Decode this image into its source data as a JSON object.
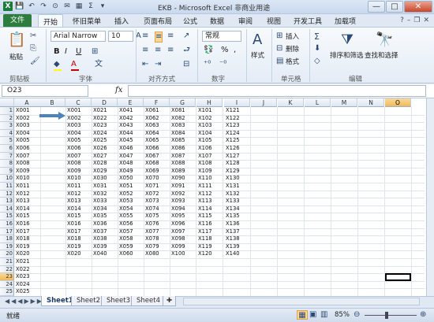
{
  "window": {
    "title": "EKB - Microsoft Excel 非商业用途",
    "controls": [
      "—",
      "□",
      "✕"
    ]
  },
  "qat": {
    "app_icon": "X",
    "save": "💾",
    "undo": "↶",
    "redo": "↷",
    "extra": [
      "⊙",
      "✉",
      "▦",
      "Σ",
      "▾"
    ]
  },
  "tabs": {
    "file": "文件",
    "items": [
      "开始",
      "怀旧菜单",
      "插入",
      "页面布局",
      "公式",
      "数据",
      "审阅",
      "视图",
      "开发工具",
      "加载项"
    ],
    "active": 0
  },
  "ribbon": {
    "clipboard": {
      "paste": "粘贴",
      "label": "剪贴板"
    },
    "font": {
      "name": "Arial Narrow",
      "size": "10",
      "label": "字体",
      "bold": "B",
      "italic": "I",
      "underline": "U",
      "font_color": "#c00000",
      "fill_color": "#ffff00"
    },
    "alignment": {
      "label": "对齐方式"
    },
    "number": {
      "format": "常规",
      "label": "数字",
      "percent": "%",
      "comma": ","
    },
    "styles": {
      "label": "样式"
    },
    "cells": {
      "insert": "插入",
      "delete": "删除",
      "format": "格式",
      "label": "单元格"
    },
    "editing": {
      "sort": "排序和筛选",
      "find": "查找和选择",
      "label": "编辑",
      "sum": "Σ"
    }
  },
  "formula_bar": {
    "name_box": "O23",
    "fx": "fx",
    "content": ""
  },
  "grid": {
    "columns": [
      "A",
      "B",
      "C",
      "D",
      "E",
      "F",
      "G",
      "H",
      "I",
      "J",
      "K",
      "L",
      "M",
      "N",
      "O"
    ],
    "selected_column": "O",
    "selected_row": 23,
    "rows": [
      1,
      2,
      3,
      4,
      5,
      6,
      7,
      8,
      9,
      10,
      11,
      12,
      13,
      14,
      15,
      16,
      17,
      18,
      19,
      20,
      21,
      22,
      23,
      24,
      25
    ],
    "col_a": [
      "X001",
      "X002",
      "X003",
      "X004",
      "X005",
      "X006",
      "X007",
      "X008",
      "X009",
      "X010",
      "X011",
      "X012",
      "X013",
      "X014",
      "X015",
      "X016",
      "X017",
      "X018",
      "X019",
      "X020",
      "X021",
      "X022",
      "X023",
      "X024",
      "X025"
    ],
    "col_c": [
      "X001",
      "X002",
      "X003",
      "X004",
      "X005",
      "X006",
      "X007",
      "X008",
      "X009",
      "X010",
      "X011",
      "X012",
      "X013",
      "X014",
      "X015",
      "X016",
      "X017",
      "X018",
      "X019",
      "X020"
    ],
    "col_d": [
      "X021",
      "X022",
      "X023",
      "X024",
      "X025",
      "X026",
      "X027",
      "X028",
      "X029",
      "X030",
      "X031",
      "X032",
      "X033",
      "X034",
      "X035",
      "X036",
      "X037",
      "X038",
      "X039",
      "X040"
    ],
    "col_e": [
      "X041",
      "X042",
      "X043",
      "X044",
      "X045",
      "X046",
      "X047",
      "X048",
      "X049",
      "X050",
      "X051",
      "X052",
      "X053",
      "X054",
      "X055",
      "X056",
      "X057",
      "X058",
      "X059",
      "X060"
    ],
    "col_f": [
      "X061",
      "X062",
      "X063",
      "X064",
      "X065",
      "X066",
      "X067",
      "X068",
      "X069",
      "X070",
      "X071",
      "X072",
      "X073",
      "X074",
      "X075",
      "X076",
      "X077",
      "X078",
      "X079",
      "X080"
    ],
    "col_g": [
      "X081",
      "X082",
      "X083",
      "X084",
      "X085",
      "X086",
      "X087",
      "X088",
      "X089",
      "X090",
      "X091",
      "X092",
      "X093",
      "X094",
      "X095",
      "X096",
      "X097",
      "X098",
      "X099",
      "X100"
    ],
    "col_h": [
      "X101",
      "X102",
      "X103",
      "X104",
      "X105",
      "X106",
      "X107",
      "X108",
      "X109",
      "X110",
      "X111",
      "X112",
      "X113",
      "X114",
      "X115",
      "X116",
      "X117",
      "X118",
      "X119",
      "X120"
    ],
    "col_i": [
      "X121",
      "X122",
      "X123",
      "X124",
      "X125",
      "X126",
      "X127",
      "X128",
      "X129",
      "X130",
      "X131",
      "X132",
      "X133",
      "X134",
      "X135",
      "X136",
      "X137",
      "X138",
      "X139",
      "X140"
    ],
    "arrow_color": "#4f81bd"
  },
  "sheets": {
    "tabs": [
      "Sheet1",
      "Sheet2",
      "Sheet3",
      "Sheet4"
    ],
    "active": 0
  },
  "status": {
    "ready": "就绪",
    "zoom": "85%"
  }
}
